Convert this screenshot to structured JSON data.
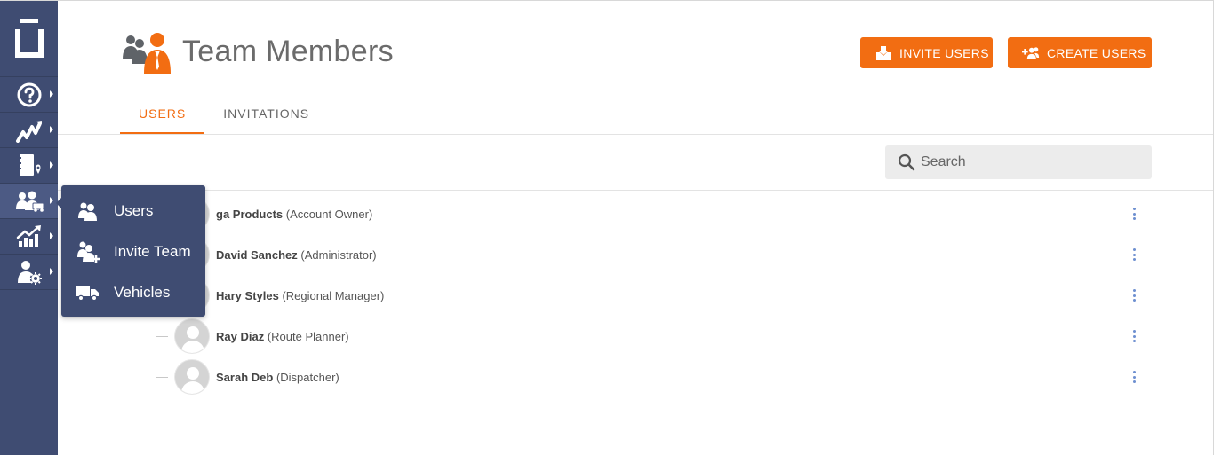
{
  "sidebar": {
    "logo_icon": "brand-logo-icon",
    "items": [
      {
        "icon": "help-icon"
      },
      {
        "icon": "routes-icon"
      },
      {
        "icon": "route-planner-icon"
      },
      {
        "icon": "team-icon",
        "active": true
      },
      {
        "icon": "analytics-icon"
      },
      {
        "icon": "user-settings-icon"
      }
    ]
  },
  "flyout": {
    "items": [
      {
        "label": "Users",
        "icon": "users-icon"
      },
      {
        "label": "Invite Team",
        "icon": "invite-team-icon"
      },
      {
        "label": "Vehicles",
        "icon": "truck-icon"
      }
    ]
  },
  "header": {
    "title": "Team Members",
    "icon": "team-members-icon",
    "invite_label": "INVITE USERS",
    "create_label": "CREATE USERS"
  },
  "tabs": [
    {
      "label": "USERS",
      "active": true
    },
    {
      "label": "INVITATIONS",
      "active": false
    }
  ],
  "search": {
    "placeholder": "Search"
  },
  "users": [
    {
      "name": "ga Products",
      "role": "(Account Owner)"
    },
    {
      "name": "David Sanchez",
      "role": "(Administrator)"
    },
    {
      "name": "Hary Styles",
      "role": "(Regional Manager)"
    },
    {
      "name": "Ray Diaz",
      "role": "(Route Planner)"
    },
    {
      "name": "Sarah Deb",
      "role": "(Dispatcher)"
    }
  ],
  "colors": {
    "accent": "#f26d12",
    "sidebar": "#3f4c72",
    "kebab": "#6d8fd0"
  }
}
